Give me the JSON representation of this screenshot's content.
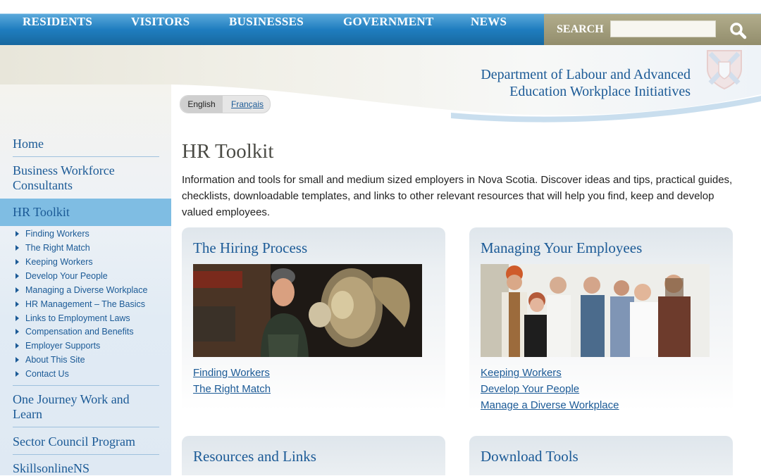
{
  "nav": {
    "items": [
      "RESIDENTS",
      "VISITORS",
      "BUSINESSES",
      "GOVERNMENT",
      "NEWS"
    ],
    "search_label": "SEARCH",
    "search_value": ""
  },
  "header": {
    "dept_line1": "Department of Labour and Advanced",
    "dept_line2": "Education Workplace Initiatives"
  },
  "language": {
    "english": "English",
    "french": "Français"
  },
  "sidebar": {
    "home": "Home",
    "business_workforce": "Business Workforce Consultants",
    "hr_toolkit": "HR Toolkit",
    "sub_items": [
      "Finding Workers",
      "The Right Match",
      "Keeping Workers",
      "Develop Your People",
      "Managing a Diverse Workplace",
      "HR Management – The Basics",
      "Links to Employment Laws",
      "Compensation and Benefits",
      "Employer Supports",
      "About This Site",
      "Contact Us"
    ],
    "one_journey": "One Journey Work and Learn",
    "sector_council": "Sector Council Program",
    "skillsonline": "SkillsonlineNS"
  },
  "main": {
    "title": "HR Toolkit",
    "intro": "Information and tools for small and medium sized employers in Nova Scotia. Discover ideas and tips, practical guides, checklists, downloadable templates, and links to other relevant resources that will help you find, keep and develop valued employees.",
    "cards": [
      {
        "title": "The Hiring Process",
        "links": [
          "Finding Workers",
          "The Right Match"
        ]
      },
      {
        "title": "Managing Your Employees",
        "links": [
          "Keeping Workers",
          "Develop Your People",
          "Manage a Diverse Workplace"
        ]
      },
      {
        "title": "Resources and Links",
        "links": []
      },
      {
        "title": "Download Tools",
        "links": []
      }
    ]
  },
  "colors": {
    "nav_blue": "#1f7dbf",
    "link_blue": "#1b5a96",
    "search_khaki": "#a39e7d",
    "sidebar_active": "#7fbde3"
  }
}
